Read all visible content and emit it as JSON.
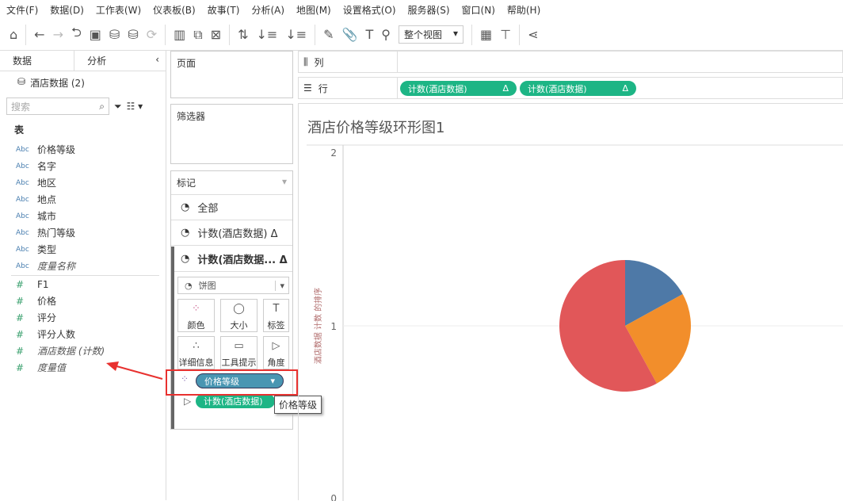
{
  "menu": [
    "文件(F)",
    "数据(D)",
    "工作表(W)",
    "仪表板(B)",
    "故事(T)",
    "分析(A)",
    "地图(M)",
    "设置格式(O)",
    "服务器(S)",
    "窗口(N)",
    "帮助(H)"
  ],
  "toolbar": {
    "view": "整个视图"
  },
  "left": {
    "tab_data": "数据",
    "tab_analysis": "分析",
    "datasource": "酒店数据 (2)",
    "search_placeholder": "搜索",
    "section": "表",
    "dimensions": [
      {
        "type": "Abc",
        "name": "价格等级"
      },
      {
        "type": "Abc",
        "name": "名字"
      },
      {
        "type": "Abc",
        "name": "地区"
      },
      {
        "type": "Abc",
        "name": "地点"
      },
      {
        "type": "Abc",
        "name": "城市"
      },
      {
        "type": "Abc",
        "name": "热门等级"
      },
      {
        "type": "Abc",
        "name": "类型"
      },
      {
        "type": "Abc",
        "name": "度量名称"
      }
    ],
    "measures": [
      {
        "type": "#",
        "name": "F1"
      },
      {
        "type": "#",
        "name": "价格"
      },
      {
        "type": "#",
        "name": "评分"
      },
      {
        "type": "#",
        "name": "评分人数"
      },
      {
        "type": "#",
        "name": "酒店数据 (计数)"
      },
      {
        "type": "#",
        "name": "度量值"
      }
    ]
  },
  "cards": {
    "pages": "页面",
    "filters": "筛选器",
    "marks": "标记",
    "all": "全部",
    "mark1": "计数(酒店数据) Δ",
    "mark2": "计数(酒店数据... Δ",
    "marktype": "饼图",
    "buttons": [
      "颜色",
      "大小",
      "标签",
      "详细信息",
      "工具提示",
      "角度"
    ],
    "color_pill": "价格等级",
    "angle_pill": "计数(酒店数据)",
    "tooltip": "价格等级"
  },
  "shelves": {
    "columns": "列",
    "rows": "行",
    "row_pills": [
      "计数(酒店数据)",
      "计数(酒店数据)"
    ],
    "delta": "Δ"
  },
  "chart_data": {
    "type": "pie",
    "title": "酒店价格等级环形图1",
    "ylabel": "酒店数据 计数 的排序",
    "yticks": [
      "2",
      "1",
      "0"
    ],
    "slices": [
      {
        "color": "#4e79a7",
        "share": 0.17
      },
      {
        "color": "#f28e2b",
        "share": 0.25
      },
      {
        "color": "#e15759",
        "share": 0.58
      }
    ]
  },
  "colors": {
    "green_pill": "#1db585",
    "blue_pill": "#4996b2",
    "highlight": "#e8312f"
  }
}
